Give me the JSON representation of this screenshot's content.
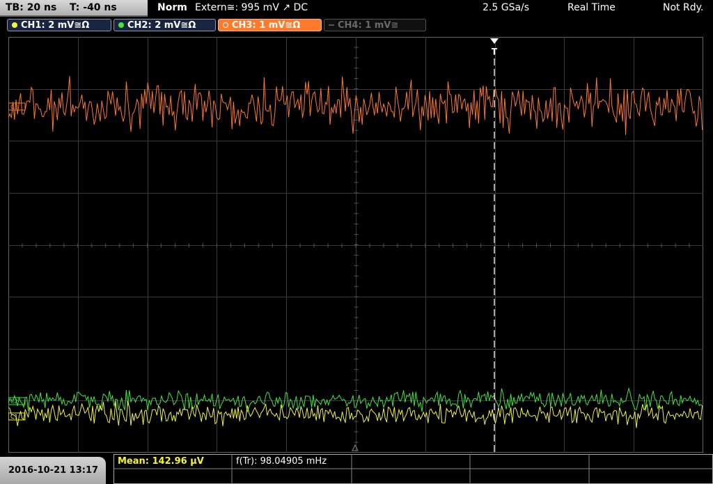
{
  "header": {
    "timebase": "TB: 20 ns",
    "trigger_time": "T: -40 ns",
    "trigger_mode": "Norm",
    "trigger_source": "Extern≅: 995 mV ↗ DC",
    "sample_rate": "2.5 GSa/s",
    "acq_mode": "Real Time",
    "status": "Not Rdy."
  },
  "channels": [
    {
      "label": "CH1: 2 mV≅Ω",
      "color": "#f5f53c",
      "active": true
    },
    {
      "label": "CH2: 2 mV≅Ω",
      "color": "#3ee83e",
      "active": true
    },
    {
      "label": "CH3: 1 mV≅Ω",
      "color": "#ff7a2a",
      "active": true,
      "selected": true
    },
    {
      "label": "CH4: 1 mV≅",
      "color": "#6a6a6a",
      "active": false
    }
  ],
  "waveform_markers": {
    "ch3": "C3",
    "ch2": "C2",
    "ch1": "C1",
    "trigger": "T"
  },
  "footer": {
    "datetime": "2016-10-21 13:17",
    "meas1": "Mean: 142.96 µV",
    "meas2": "f(Tr): 98.04905 mHz"
  },
  "colors": {
    "ch1": "#f5f53c",
    "ch2": "#3ee83e",
    "ch3": "#ff7a2a",
    "grid": "#3a3a3a"
  }
}
